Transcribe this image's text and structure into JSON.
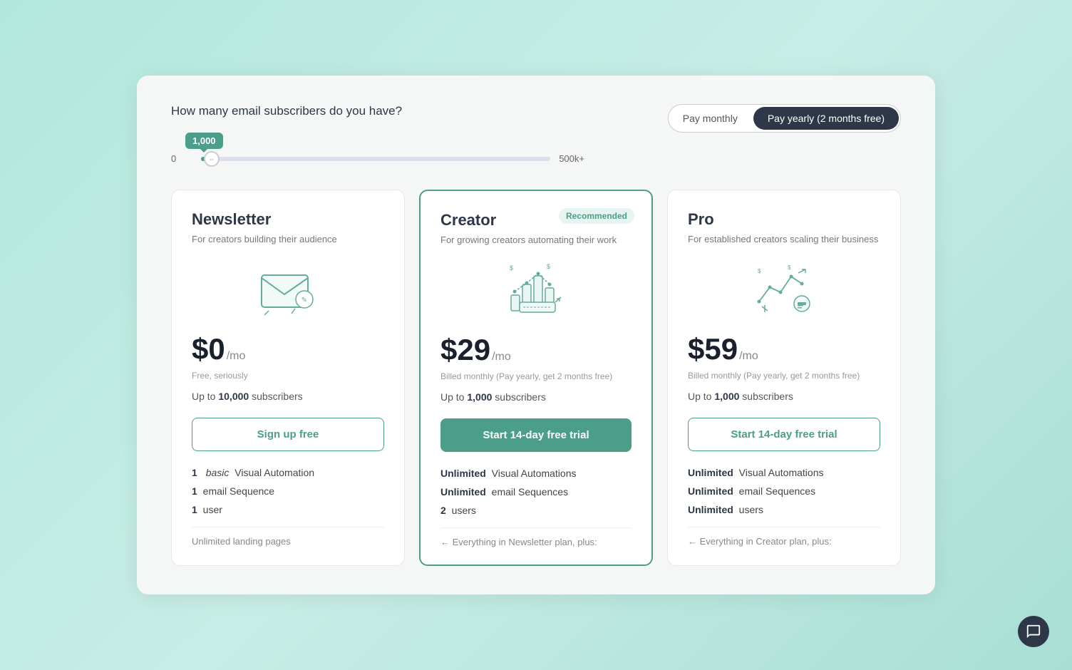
{
  "page": {
    "background": "#b2e8dc"
  },
  "slider": {
    "label": "How many email subscribers do you have?",
    "tooltip": "1,000",
    "min": "0",
    "max": "500k+",
    "value": 3
  },
  "billing": {
    "options": [
      {
        "id": "monthly",
        "label": "Pay monthly",
        "active": false
      },
      {
        "id": "yearly",
        "label": "Pay yearly (2 months free)",
        "active": true
      }
    ]
  },
  "plans": [
    {
      "id": "newsletter",
      "name": "Newsletter",
      "desc": "For creators building their audience",
      "price": "$0",
      "period": "/mo",
      "billing_note": "Free, seriously",
      "subscribers": "Up to 10,000 subscribers",
      "subscribers_bold": "10,000",
      "cta": "Sign up free",
      "cta_style": "outline",
      "recommended": false,
      "features": [
        {
          "bold": "1",
          "italic": "basic",
          "rest": " Visual Automation"
        },
        {
          "bold": "1",
          "italic": "",
          "rest": " email Sequence"
        },
        {
          "bold": "1",
          "italic": "",
          "rest": " user"
        }
      ],
      "footer": "Unlimited landing pages"
    },
    {
      "id": "creator",
      "name": "Creator",
      "desc": "For growing creators automating their work",
      "price": "$29",
      "period": "/mo",
      "billing_note": "Billed monthly (Pay yearly, get 2 months free)",
      "subscribers": "Up to 1,000 subscribers",
      "subscribers_bold": "1,000",
      "cta": "Start 14-day free trial",
      "cta_style": "filled",
      "recommended": true,
      "recommended_label": "Recommended",
      "features": [
        {
          "bold": "Unlimited",
          "italic": "",
          "rest": " Visual Automations"
        },
        {
          "bold": "Unlimited",
          "italic": "",
          "rest": " email Sequences"
        },
        {
          "bold": "2",
          "italic": "",
          "rest": " users"
        }
      ],
      "footer": "← Everything in Newsletter plan, plus:"
    },
    {
      "id": "pro",
      "name": "Pro",
      "desc": "For established creators scaling their business",
      "price": "$59",
      "period": "/mo",
      "billing_note": "Billed monthly (Pay yearly, get 2 months free)",
      "subscribers": "Up to 1,000 subscribers",
      "subscribers_bold": "1,000",
      "cta": "Start 14-day free trial",
      "cta_style": "outline",
      "recommended": false,
      "features": [
        {
          "bold": "Unlimited",
          "italic": "",
          "rest": " Visual Automations"
        },
        {
          "bold": "Unlimited",
          "italic": "",
          "rest": " email Sequences"
        },
        {
          "bold": "Unlimited",
          "italic": "",
          "rest": " users"
        }
      ],
      "footer": "← Everything in Creator plan, plus:"
    }
  ]
}
